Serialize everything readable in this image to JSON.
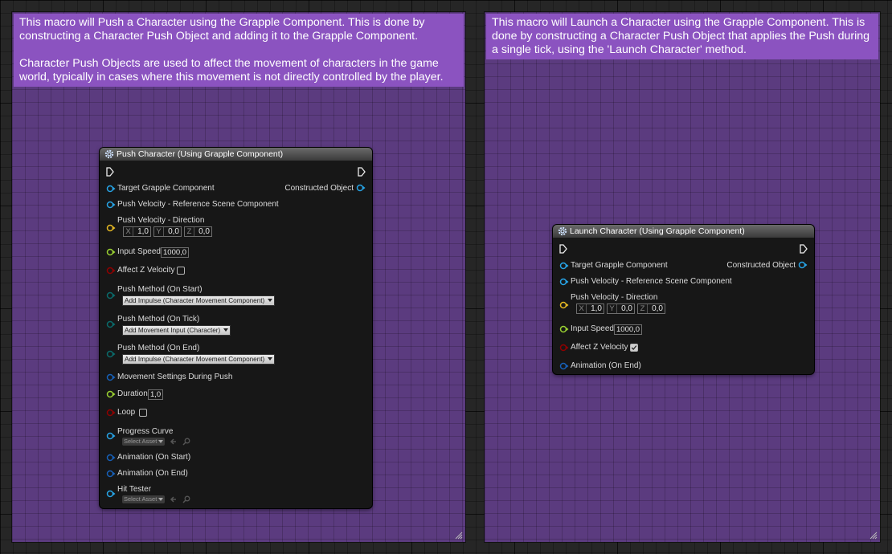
{
  "comments": [
    {
      "text": "This macro will Push a Character using the Grapple Component. This is done by constructing a Character Push Object and adding it to the Grapple Component.\n\nCharacter Push Objects are used to affect the movement of characters in the game world, typically in cases where this movement is not directly controlled by the player."
    },
    {
      "text": "This macro will Launch a Character using the Grapple Component. This is done by constructing a Character Push Object that applies the Push during a single tick, using the 'Launch Character' method."
    }
  ],
  "colors": {
    "object_pin": "#27a4e6",
    "vector_pin": "#e5b823",
    "float_pin": "#9ad132",
    "bool_pin": "#8f0000",
    "enum_pin": "#0a6b6b",
    "struct_pin": "#1760b8"
  },
  "push_node": {
    "title": "Push Character (Using Grapple Component)",
    "target_label": "Target Grapple Component",
    "constructed_label": "Constructed Object",
    "ref_scene_label": "Push Velocity - Reference Scene Component",
    "direction_label": "Push Velocity - Direction",
    "dir_x_axis": "X",
    "dir_x": "1,0",
    "dir_y_axis": "Y",
    "dir_y": "0,0",
    "dir_z_axis": "Z",
    "dir_z": "0,0",
    "input_speed_label": "Input Speed",
    "input_speed": "1000,0",
    "affect_z_label": "Affect Z Velocity",
    "affect_z_checked": false,
    "method_start_label": "Push Method (On Start)",
    "method_start_value": "Add Impulse (Character Movement Component)",
    "method_tick_label": "Push Method (On Tick)",
    "method_tick_value": "Add Movement Input (Character)",
    "method_end_label": "Push Method (On End)",
    "method_end_value": "Add Impulse (Character Movement Component)",
    "movement_settings_label": "Movement Settings During Push",
    "duration_label": "Duration",
    "duration": "1,0",
    "loop_label": "Loop",
    "loop_checked": false,
    "progress_curve_label": "Progress Curve",
    "select_asset": "Select Asset",
    "anim_start_label": "Animation (On Start)",
    "anim_end_label": "Animation (On End)",
    "hit_tester_label": "Hit Tester"
  },
  "launch_node": {
    "title": "Launch Character (Using Grapple Component)",
    "target_label": "Target Grapple Component",
    "constructed_label": "Constructed Object",
    "ref_scene_label": "Push Velocity - Reference Scene Component",
    "direction_label": "Push Velocity - Direction",
    "dir_x_axis": "X",
    "dir_x": "1,0",
    "dir_y_axis": "Y",
    "dir_y": "0,0",
    "dir_z_axis": "Z",
    "dir_z": "0,0",
    "input_speed_label": "Input Speed",
    "input_speed": "1000,0",
    "affect_z_label": "Affect Z Velocity",
    "affect_z_checked": true,
    "anim_end_label": "Animation (On End)"
  }
}
